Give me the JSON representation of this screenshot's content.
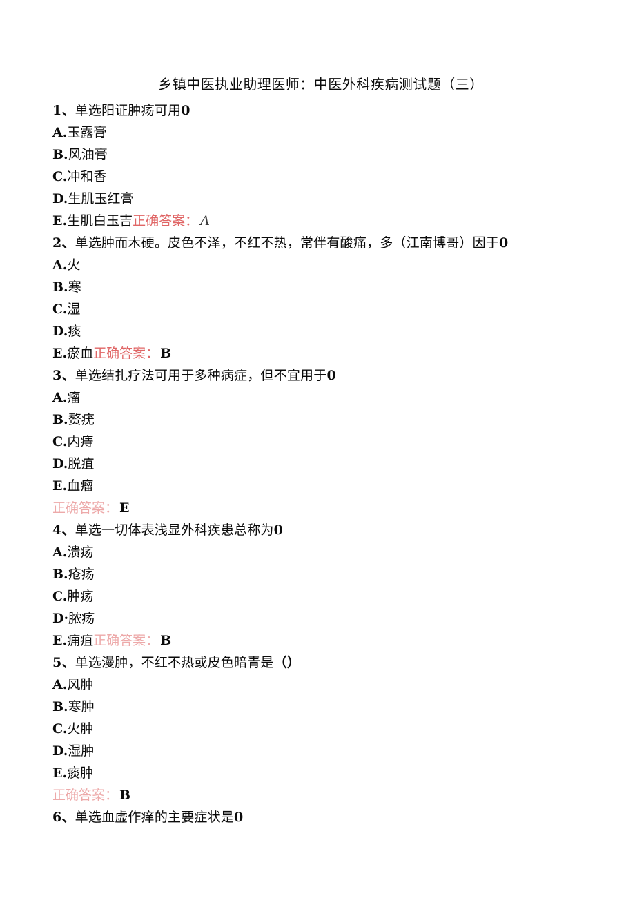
{
  "document": {
    "title": "乡镇中医执业助理医师：中医外科疾病测试题（三）",
    "answer_label": "正确答案：",
    "colors": {
      "answer_red": "#e06666",
      "answer_pink": "#eda9a9",
      "text_black": "#0b0b0b"
    }
  },
  "questions": [
    {
      "number": "1、",
      "type": "单选",
      "stem": "阳证肿疡可用",
      "tail": "0",
      "options": [
        {
          "key": "A.",
          "text": "玉露膏"
        },
        {
          "key": "B.",
          "text": "风油膏"
        },
        {
          "key": "C.",
          "text": "冲和香"
        },
        {
          "key": "D.",
          "text": "生肌玉红膏"
        },
        {
          "key": "E.",
          "text": "生肌白玉吉"
        }
      ],
      "answer": "A",
      "answer_inline": true,
      "answer_style": "italic",
      "answer_label_tone": "red"
    },
    {
      "number": "2、",
      "type": "单选",
      "stem": "肿而木硬。皮色不泽，不红不热，常伴有酸痛，多（江南博哥）因于",
      "tail": "0",
      "options": [
        {
          "key": "A.",
          "text": "火"
        },
        {
          "key": "B.",
          "text": "寒"
        },
        {
          "key": "C.",
          "text": "湿"
        },
        {
          "key": "D.",
          "text": "痰"
        },
        {
          "key": "E.",
          "text": "瘀血"
        }
      ],
      "answer": "B",
      "answer_inline": true,
      "answer_style": "bold",
      "answer_label_tone": "red"
    },
    {
      "number": "3、",
      "type": "单选",
      "stem": "结扎疗法可用于多种病症，但不宜用于",
      "tail": "0",
      "options": [
        {
          "key": "A.",
          "text": "瘤"
        },
        {
          "key": "B.",
          "text": "赘疣"
        },
        {
          "key": "C.",
          "text": "内痔"
        },
        {
          "key": "D.",
          "text": "脱疽"
        },
        {
          "key": "E.",
          "text": "血瘤"
        }
      ],
      "answer": "E",
      "answer_inline": false,
      "answer_style": "bold",
      "answer_label_tone": "pink"
    },
    {
      "number": "4、",
      "type": "单选",
      "stem": "一切体表浅显外科疾患总称为",
      "tail": "0",
      "options": [
        {
          "key": "A.",
          "text": "溃疡"
        },
        {
          "key": "B.",
          "text": "疮疡"
        },
        {
          "key": "C.",
          "text": "肿疡"
        },
        {
          "key": "D·",
          "text": "脓疡"
        },
        {
          "key": "E.",
          "text": "痈疽"
        }
      ],
      "answer": "B",
      "answer_inline": true,
      "answer_style": "bold",
      "answer_label_tone": "pink"
    },
    {
      "number": "5、",
      "type": "单选",
      "stem": "漫肿，不红不热或皮色暗青是",
      "tail": "（）",
      "options": [
        {
          "key": "A.",
          "text": "风肿"
        },
        {
          "key": "B.",
          "text": "寒肿"
        },
        {
          "key": "C.",
          "text": "火肿"
        },
        {
          "key": "D.",
          "text": "湿肿"
        },
        {
          "key": "E.",
          "text": "痰肿"
        }
      ],
      "answer": "B",
      "answer_inline": false,
      "answer_style": "bold",
      "answer_label_tone": "pink"
    },
    {
      "number": "6、",
      "type": "单选",
      "stem": "血虚作痒的主要症状是",
      "tail": "0",
      "options": [],
      "answer": "",
      "answer_inline": false,
      "answer_style": "bold",
      "answer_label_tone": "pink"
    }
  ]
}
